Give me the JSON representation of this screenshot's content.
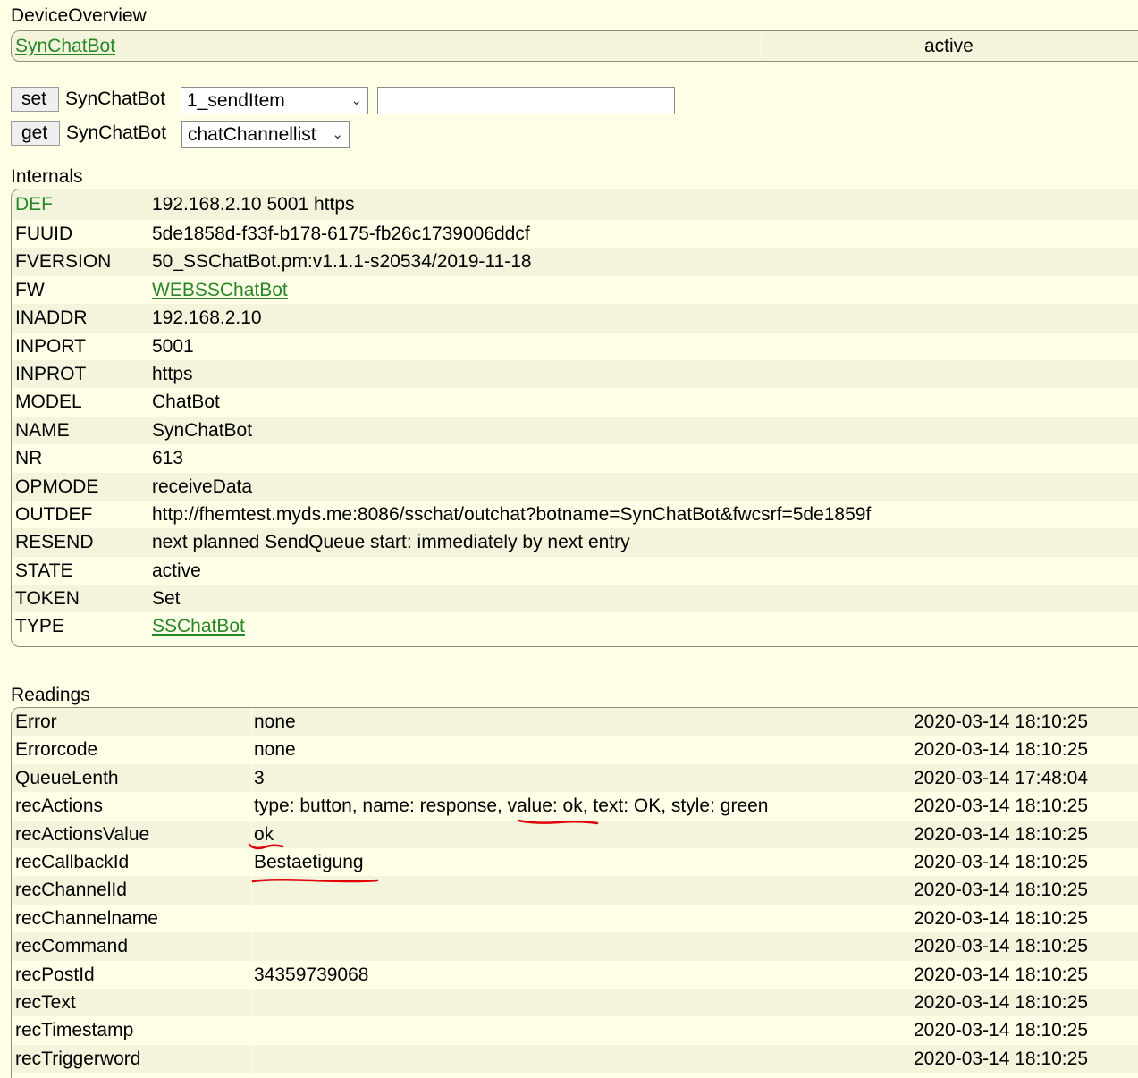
{
  "overview": {
    "title": "DeviceOverview",
    "device_name": "SynChatBot",
    "state": "active"
  },
  "set_command": {
    "button": "set",
    "device": "SynChatBot",
    "selected": "1_sendItem",
    "input_value": ""
  },
  "get_command": {
    "button": "get",
    "device": "SynChatBot",
    "selected": "chatChannellist"
  },
  "internals": {
    "title": "Internals",
    "rows": [
      {
        "key": "DEF",
        "value": "192.168.2.10 5001 https"
      },
      {
        "key": "FUUID",
        "value": "5de1858d-f33f-b178-6175-fb26c1739006ddcf"
      },
      {
        "key": "FVERSION",
        "value": "50_SSChatBot.pm:v1.1.1-s20534/2019-11-18"
      },
      {
        "key": "FW",
        "value": "WEBSSChatBot"
      },
      {
        "key": "INADDR",
        "value": "192.168.2.10"
      },
      {
        "key": "INPORT",
        "value": "5001"
      },
      {
        "key": "INPROT",
        "value": "https"
      },
      {
        "key": "MODEL",
        "value": "ChatBot"
      },
      {
        "key": "NAME",
        "value": "SynChatBot"
      },
      {
        "key": "NR",
        "value": "613"
      },
      {
        "key": "OPMODE",
        "value": "receiveData"
      },
      {
        "key": "OUTDEF",
        "value": "http://fhemtest.myds.me:8086/sschat/outchat?botname=SynChatBot&fwcsrf=5de1859f"
      },
      {
        "key": "RESEND",
        "value": "next planned SendQueue start: immediately by next entry"
      },
      {
        "key": "STATE",
        "value": "active"
      },
      {
        "key": "TOKEN",
        "value": "Set"
      },
      {
        "key": "TYPE",
        "value": "SSChatBot"
      }
    ]
  },
  "readings": {
    "title": "Readings",
    "rows": [
      {
        "key": "Error",
        "value": "none",
        "time": "2020-03-14 18:10:25"
      },
      {
        "key": "Errorcode",
        "value": "none",
        "time": "2020-03-14 18:10:25"
      },
      {
        "key": "QueueLenth",
        "value": "3",
        "time": "2020-03-14 17:48:04"
      },
      {
        "key": "recActions",
        "value": "type: button, name: response, value: ok, text: OK, style: green",
        "time": "2020-03-14 18:10:25"
      },
      {
        "key": "recActionsValue",
        "value": "ok",
        "time": "2020-03-14 18:10:25"
      },
      {
        "key": "recCallbackId",
        "value": "Bestaetigung",
        "time": "2020-03-14 18:10:25"
      },
      {
        "key": "recChannelId",
        "value": "",
        "time": "2020-03-14 18:10:25"
      },
      {
        "key": "recChannelname",
        "value": "",
        "time": "2020-03-14 18:10:25"
      },
      {
        "key": "recCommand",
        "value": "",
        "time": "2020-03-14 18:10:25"
      },
      {
        "key": "recPostId",
        "value": "34359739068",
        "time": "2020-03-14 18:10:25"
      },
      {
        "key": "recText",
        "value": "",
        "time": "2020-03-14 18:10:25"
      },
      {
        "key": "recTimestamp",
        "value": "",
        "time": "2020-03-14 18:10:25"
      },
      {
        "key": "recTriggerword",
        "value": "",
        "time": "2020-03-14 18:10:25"
      }
    ]
  },
  "colors": {
    "link": "#278727",
    "annotation": "#e0000a",
    "row_odd": "#f4f4dd",
    "background": "#ffffe7"
  }
}
